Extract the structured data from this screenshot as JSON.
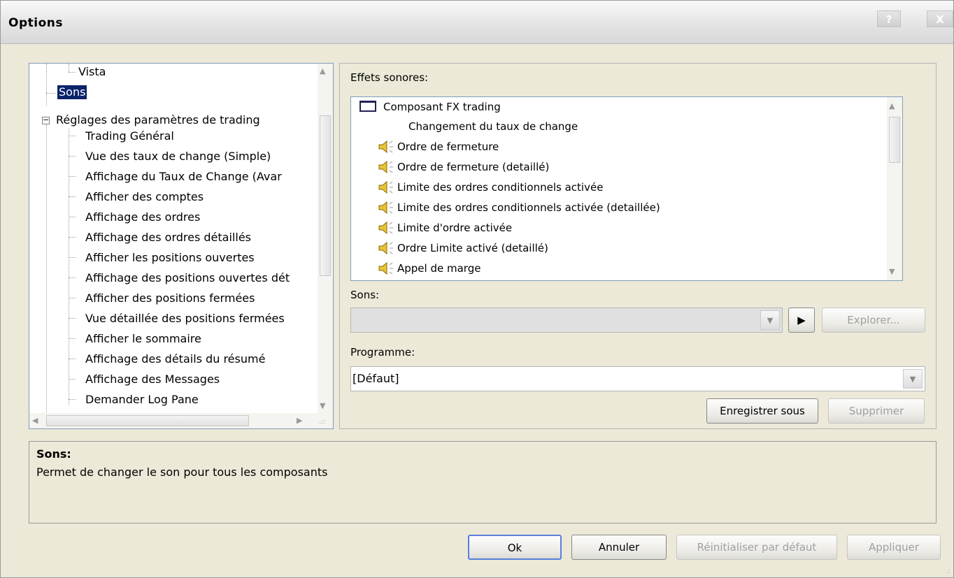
{
  "window": {
    "title": "Options",
    "help_label": "?",
    "close_label": "X"
  },
  "tree": {
    "items": [
      "Vista",
      "Sons",
      "Réglages des paramètres de trading",
      "Trading Général",
      "Vue des taux de change (Simple)",
      "Affichage du Taux de Change (Avar",
      "Afficher des comptes",
      "Affichage des ordres",
      "Affichage des ordres détaillés",
      "Afficher les positions ouvertes",
      "Affichage des positions ouvertes dét",
      "Afficher des positions fermées",
      "Vue détaillée des positions fermées",
      "Afficher le sommaire",
      "Affichage des détails du résumé",
      "Affichage des Messages",
      "Demander Log Pane"
    ],
    "selected": "Sons",
    "expander_symbol": "−"
  },
  "effects": {
    "label": "Effets sonores:",
    "items": [
      "Composant FX trading",
      "Changement du taux de change",
      "Ordre de fermeture",
      "Ordre de fermeture (detaillé)",
      "Limite des ordres conditionnels activée",
      "Limite des ordres conditionnels activée (detaillée)",
      "Limite d'ordre activée",
      "Ordre Limite activé (detaillé)",
      "Appel de marge"
    ]
  },
  "sounds": {
    "label": "Sons:",
    "value": "",
    "play_symbol": "▶",
    "explore_label": "Explorer..."
  },
  "program": {
    "label": "Programme:",
    "value": "[Défaut]",
    "save_as_label": "Enregistrer sous",
    "delete_label": "Supprimer"
  },
  "description": {
    "title": "Sons:",
    "text": "Permet de changer le son pour tous les composants"
  },
  "footer": {
    "ok": "Ok",
    "cancel": "Annuler",
    "reset": "Réinitialiser par défaut",
    "apply": "Appliquer"
  },
  "colors": {
    "selection": "#0a246a",
    "dialog_bg": "#ece9d8",
    "default_button_border": "#5a7edc"
  }
}
